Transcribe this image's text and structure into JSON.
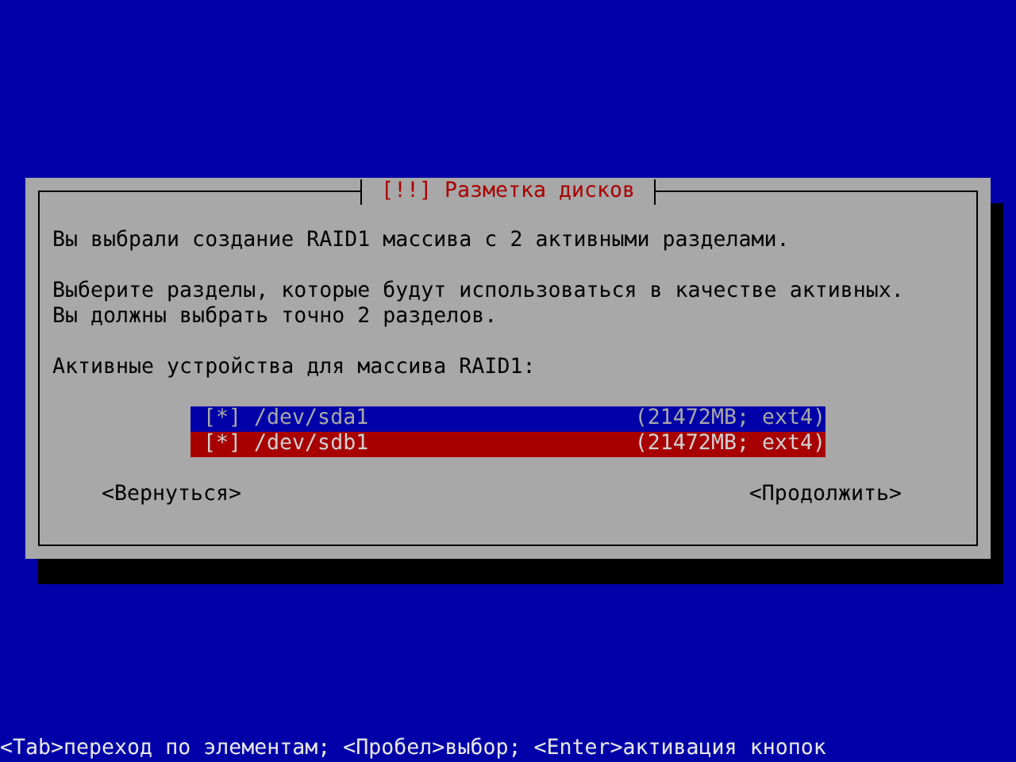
{
  "dialog": {
    "title": "[!!] Разметка дисков",
    "paragraphs": [
      [
        "Вы выбрали создание RAID1 массива с 2 активными разделами."
      ],
      [
        "Выберите разделы, которые будут использоваться в качестве активных.",
        "Вы должны выбрать точно 2 разделов."
      ],
      [
        "Активные устройства для массива RAID1:"
      ]
    ],
    "items": [
      {
        "checkbox": "[*]",
        "device": "/dev/sda1",
        "info": "(21472MB; ext4)",
        "selected": false
      },
      {
        "checkbox": "[*]",
        "device": "/dev/sdb1",
        "info": "(21472MB; ext4)",
        "selected": true
      }
    ],
    "buttons": [
      "<Вернуться>",
      "<Продолжить>"
    ]
  },
  "status_bar": "<Tab>переход по элементам; <Пробел>выбор; <Enter>активация кнопок"
}
